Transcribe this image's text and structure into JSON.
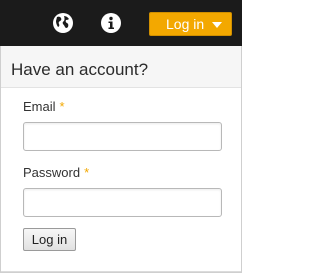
{
  "topbar": {
    "icons": [
      "globe-icon",
      "info-icon"
    ],
    "login_toggle_label": "Log in",
    "accent_color": "#f3a800",
    "background_color": "#1b1b1b"
  },
  "login_panel": {
    "title": "Have an account?",
    "email": {
      "label": "Email",
      "required_marker": "*",
      "value": ""
    },
    "password": {
      "label": "Password",
      "required_marker": "*",
      "value": ""
    },
    "submit_label": "Log in"
  }
}
